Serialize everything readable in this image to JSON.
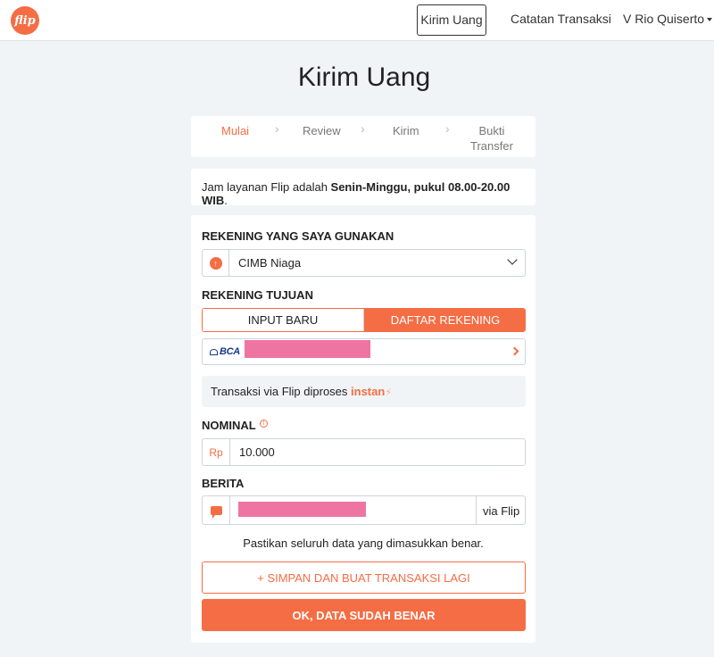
{
  "navbar": {
    "logo_text": "flip",
    "links": [
      "Kirim Uang",
      "Catatan Transaksi",
      "V Rio Quiserto"
    ]
  },
  "page": {
    "title": "Kirim Uang"
  },
  "steps": {
    "items": [
      "Mulai",
      "Review",
      "Kirim",
      "Bukti Transfer"
    ],
    "bukti_line1": "Bukti",
    "bukti_line2": "Transfer",
    "active": "Mulai"
  },
  "info": {
    "prefix": "Jam layanan Flip adalah ",
    "bold": "Senin-Minggu, pukul 08.00-20.00 WIB",
    "suffix": "."
  },
  "form": {
    "source_label": "REKENING YANG SAYA GUNAKAN",
    "source_bank": "CIMB Niaga",
    "dest_label": "REKENING TUJUAN",
    "tab_new": "INPUT BARU",
    "tab_list": "DAFTAR REKENING",
    "dest_bank_logo": "BCA",
    "instan_prefix": "Transaksi via Flip diproses ",
    "instan_word": "instan",
    "nominal_label": "NOMINAL",
    "currency": "Rp",
    "nominal_value": "10.000",
    "berita_label": "BERITA",
    "berita_suffix": "via Flip",
    "confirm_text": "Pastikan seluruh data yang dimasukkan benar.",
    "save_button": "+ SIMPAN DAN BUAT TRANSAKSI LAGI",
    "ok_button": "OK, DATA SUDAH BENAR"
  },
  "colors": {
    "accent": "#f56d44",
    "redaction": "#ee75a1",
    "background": "#f1f4f7"
  }
}
